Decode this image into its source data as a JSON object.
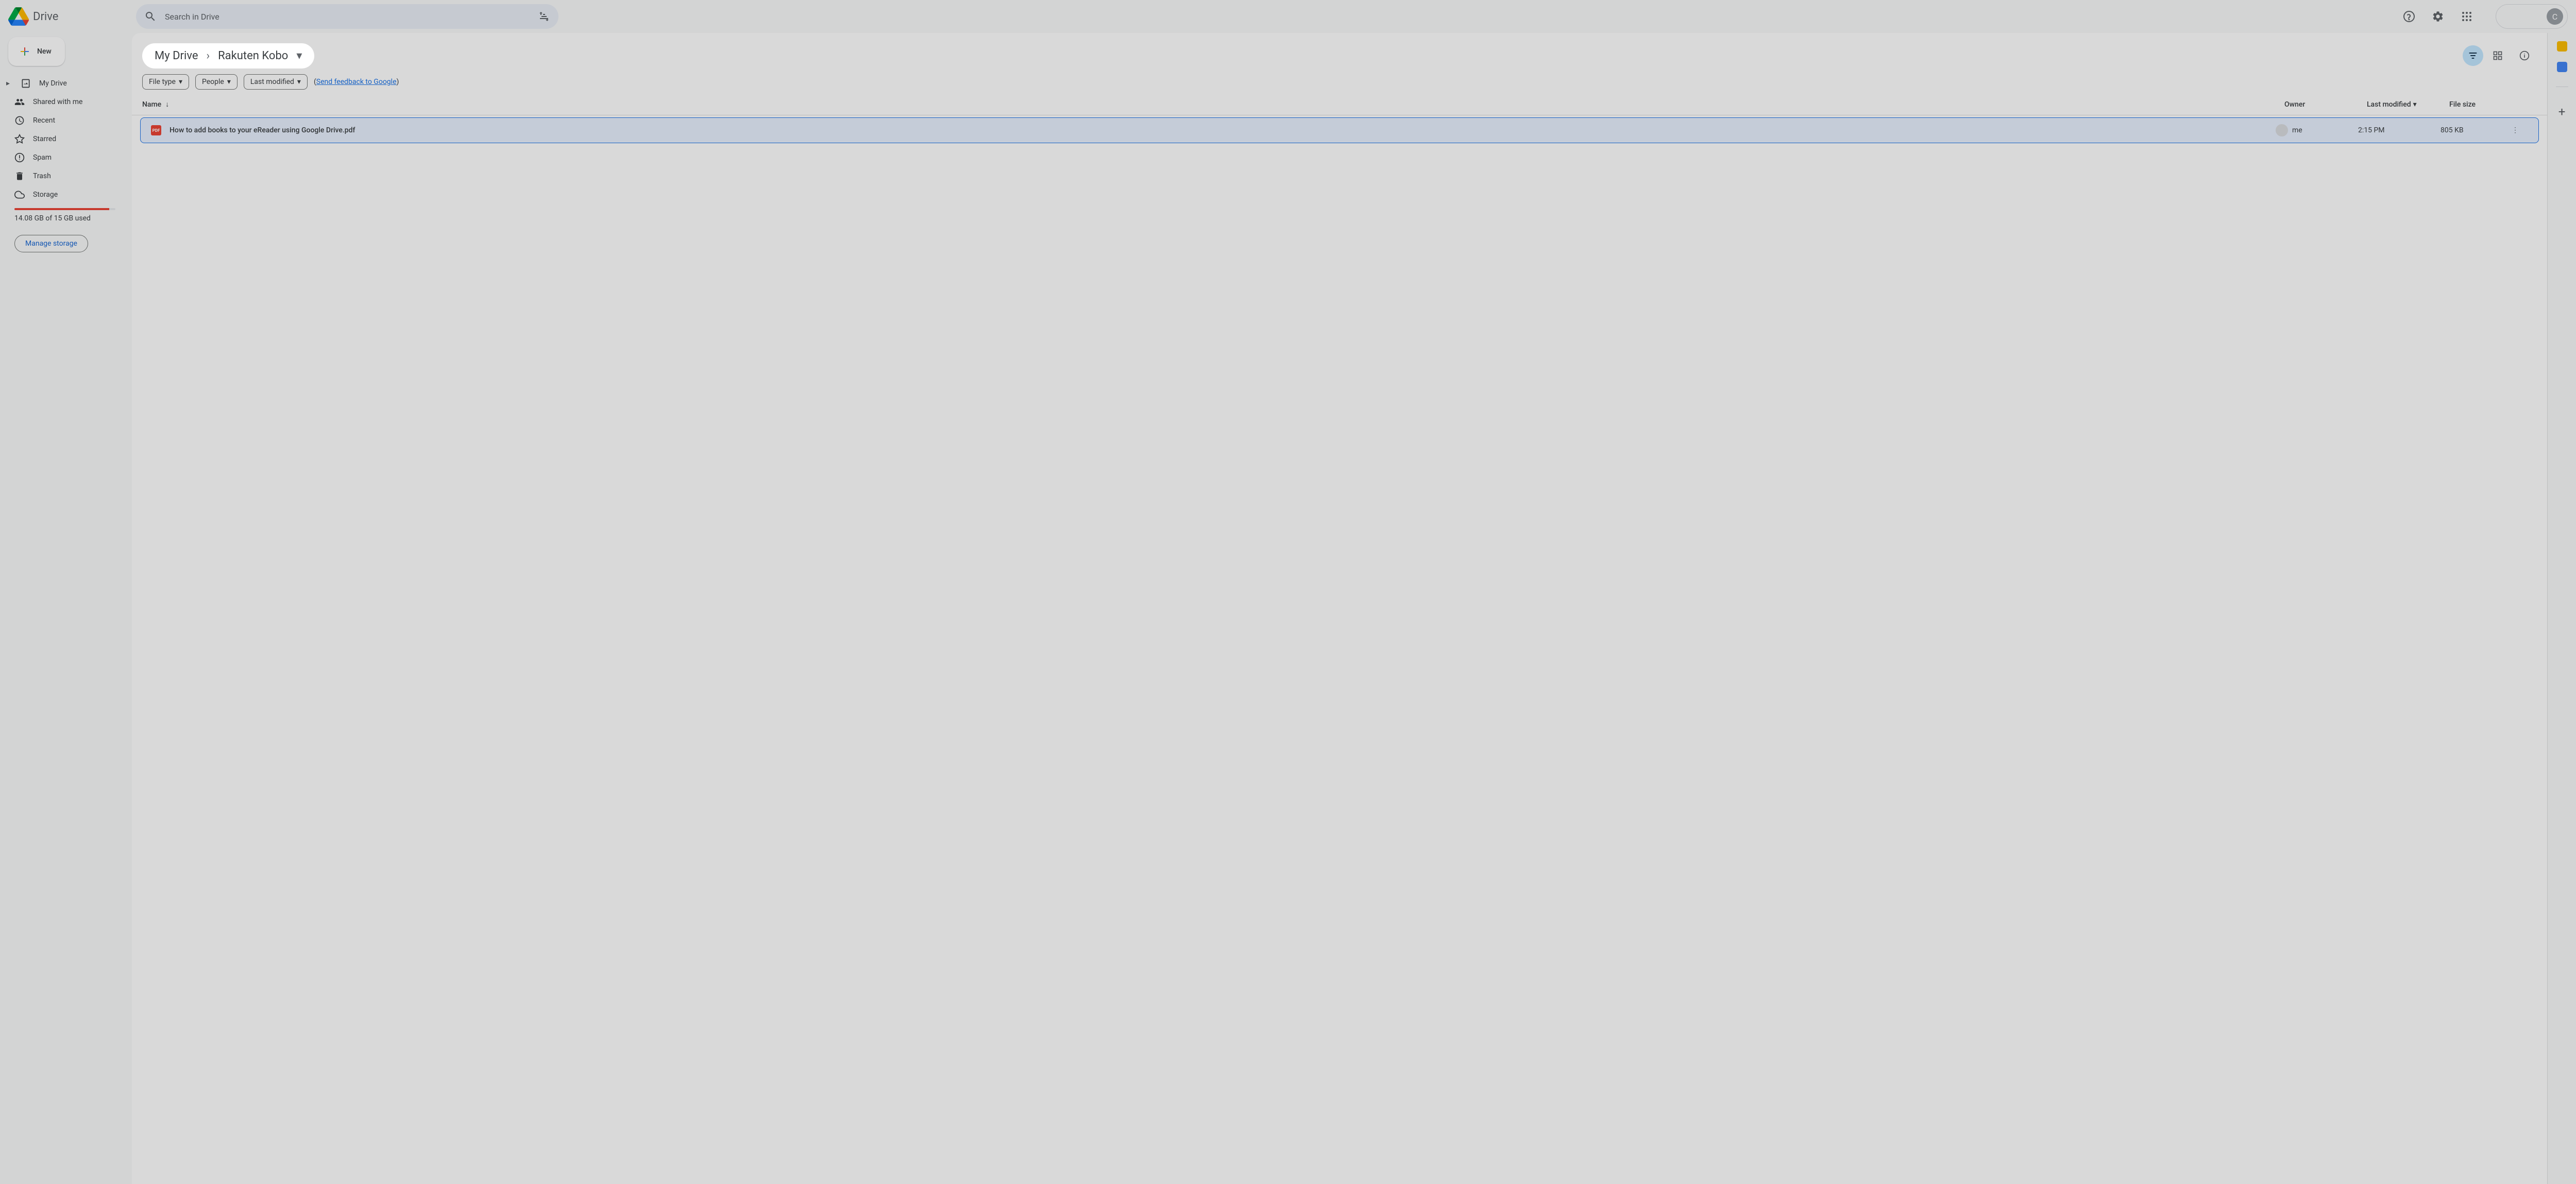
{
  "app": {
    "name": "Drive"
  },
  "search": {
    "placeholder": "Search in Drive"
  },
  "header": {
    "avatar_letter": "C"
  },
  "sidebar": {
    "new_button": "New",
    "nav": [
      {
        "label": "My Drive",
        "icon": "drive"
      },
      {
        "label": "Shared with me",
        "icon": "people"
      },
      {
        "label": "Recent",
        "icon": "clock"
      },
      {
        "label": "Starred",
        "icon": "star"
      },
      {
        "label": "Spam",
        "icon": "spam"
      },
      {
        "label": "Trash",
        "icon": "trash"
      },
      {
        "label": "Storage",
        "icon": "cloud"
      }
    ],
    "storage_text": "14.08 GB of 15 GB used",
    "storage_percent": 94,
    "manage_storage": "Manage storage"
  },
  "breadcrumb": {
    "parts": [
      "My Drive",
      "Rakuten Kobo"
    ]
  },
  "filters": {
    "chips": [
      "File type",
      "People",
      "Last modified"
    ],
    "feedback_prefix": "(",
    "feedback_link": "Send feedback to Google",
    "feedback_suffix": ")"
  },
  "table": {
    "headers": {
      "name": "Name",
      "owner": "Owner",
      "modified": "Last modified",
      "size": "File size"
    },
    "rows": [
      {
        "icon": "PDF",
        "name": "How to add books to your eReader using Google Drive.pdf",
        "owner": "me",
        "modified": "2:15 PM",
        "size": "805 KB"
      }
    ]
  }
}
